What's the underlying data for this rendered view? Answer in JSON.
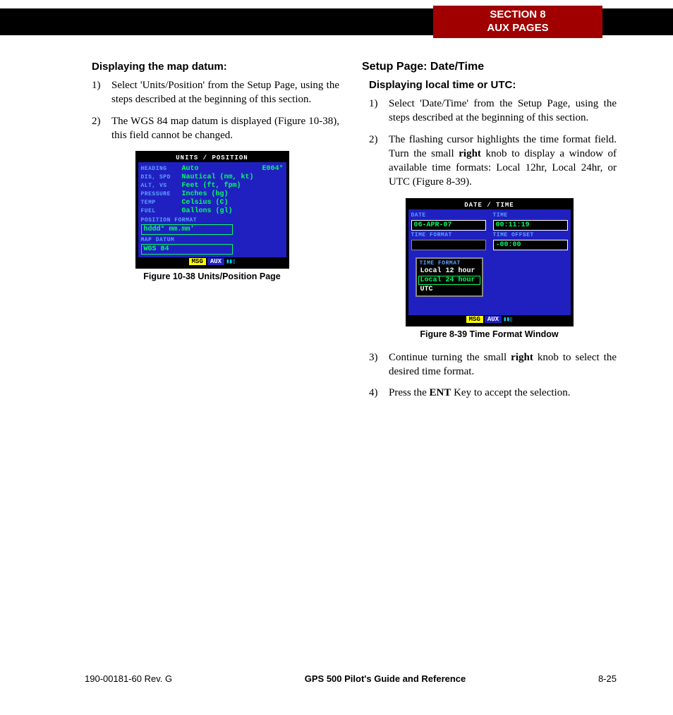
{
  "header": {
    "section_line1": "SECTION 8",
    "section_line2": "AUX PAGES"
  },
  "left": {
    "h4": "Displaying the map datum:",
    "steps": [
      "Select 'Units/Position' from the Setup Page, using the steps described at the beginning of this section.",
      "The WGS 84 map datum is displayed (Figure 10-38), this field cannot be changed."
    ],
    "fig_caption": "Figure 10-38  Units/Position Page",
    "gps": {
      "title": "UNITS / POSITION",
      "heading_val_right": "E004°",
      "rows": [
        {
          "label": "HEADING",
          "val": "Auto"
        },
        {
          "label": "DIS, SPD",
          "val": "Nautical (nm, kt)"
        },
        {
          "label": "ALT, VS",
          "val": "Feet (ft, fpm)"
        },
        {
          "label": "PRESSURE",
          "val": "Inches (hg)"
        },
        {
          "label": "TEMP",
          "val": "Celsius (C)"
        },
        {
          "label": "FUEL",
          "val": "Gallons (gl)"
        }
      ],
      "pos_format_label": "POSITION FORMAT",
      "pos_format_val": "hddd° mm.mm'",
      "map_datum_label": "MAP DATUM",
      "map_datum_val": "WGS 84",
      "msg": "MSG",
      "aux": "AUX"
    }
  },
  "right": {
    "h3": "Setup Page: Date/Time",
    "h4": "Displaying local time or UTC:",
    "steps_a": [
      "Select 'Date/Time' from the Setup Page, using the steps described at the beginning of this section."
    ],
    "step2_pre": "The flashing cursor highlights the time format field.  Turn the small ",
    "step2_bold1": "right",
    "step2_post": " knob to display a window of available time formats: Local 12hr, Local 24hr, or UTC (Figure 8-39).",
    "fig_caption": "Figure 8-39  Time Format Window",
    "step3_pre": "Continue turning the small ",
    "step3_bold": "right",
    "step3_post": " knob to select the desired time format.",
    "step4_pre": "Press the ",
    "step4_bold": "ENT",
    "step4_post": " Key to accept the selection.",
    "gps": {
      "title": "DATE / TIME",
      "date_label": "DATE",
      "time_label": "TIME",
      "date_val": "06-APR-07",
      "time_val": "00:11:19",
      "tf_label": "TIME FORMAT",
      "to_label": "TIME OFFSET",
      "to_val": "-00:00",
      "popup_title": "TIME FORMAT",
      "popup_items": [
        "Local 12 hour",
        "Local 24 hour",
        "UTC"
      ],
      "msg": "MSG",
      "aux": "AUX"
    }
  },
  "footer": {
    "left": "190-00181-60  Rev. G",
    "center": "GPS 500 Pilot's Guide and Reference",
    "right": "8-25"
  }
}
